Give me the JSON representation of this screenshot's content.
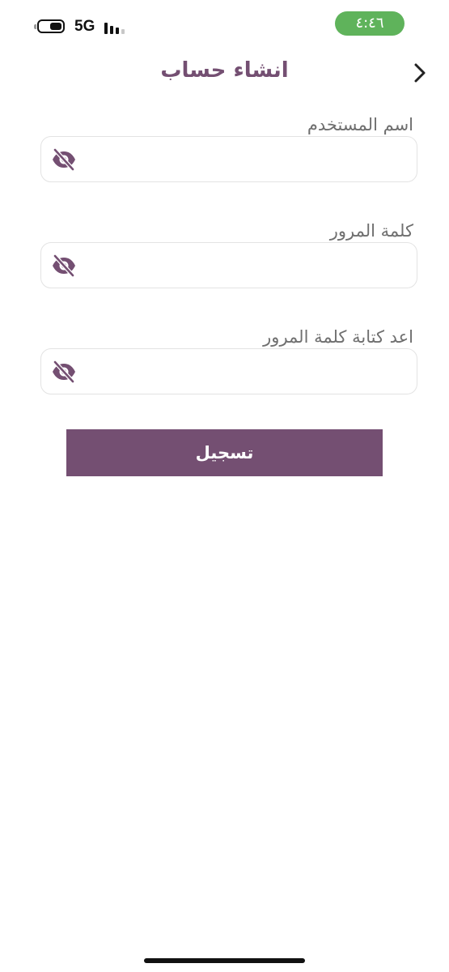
{
  "status_bar": {
    "network": "5G",
    "time": "٤:٤٦",
    "battery_level": 0.55,
    "signal_bars": 3,
    "signal_total": 4,
    "time_pill_color": "#5fb35b"
  },
  "header": {
    "title": "انشاء حساب",
    "back_icon": "chevron-right-icon"
  },
  "form": {
    "username_label": "اسم المستخدم",
    "username_value": "",
    "password_label": "كلمة المرور",
    "password_value": "",
    "confirm_password_label": "اعد كتابة كلمة المرور",
    "confirm_password_value": "",
    "visibility_icon": "eye-off-icon",
    "submit_label": "تسجيل"
  },
  "colors": {
    "brand": "#744f72",
    "label": "#6f6f6f",
    "border": "#e3e3e3"
  }
}
